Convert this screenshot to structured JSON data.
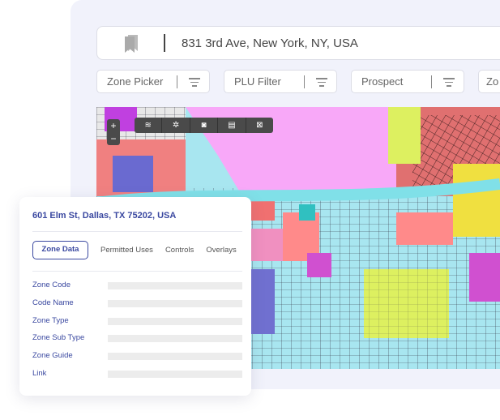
{
  "search": {
    "address": "831 3rd Ave, New York, NY, USA",
    "icon": "bookmark-icon"
  },
  "filters": [
    {
      "label": "Zone Picker"
    },
    {
      "label": "PLU Filter"
    },
    {
      "label": "Prospect"
    },
    {
      "label": "Zo"
    }
  ],
  "map": {
    "zoom_in": "+",
    "zoom_out": "−",
    "tools": [
      "layers-icon",
      "measure-icon",
      "camera-icon",
      "print-icon",
      "grid-icon"
    ]
  },
  "card": {
    "title": "601 Elm St, Dallas, TX 75202, USA",
    "tabs": [
      "Zone Data",
      "Permitted Uses",
      "Controls",
      "Overlays"
    ],
    "active_tab": "Zone Data",
    "fields": [
      "Zone Code",
      "Code Name",
      "Zone Type",
      "Zone Sub Type",
      "Zone Guide",
      "Link"
    ]
  },
  "colors": {
    "accent": "#3a48a0",
    "panel": "#f1f2fb"
  }
}
